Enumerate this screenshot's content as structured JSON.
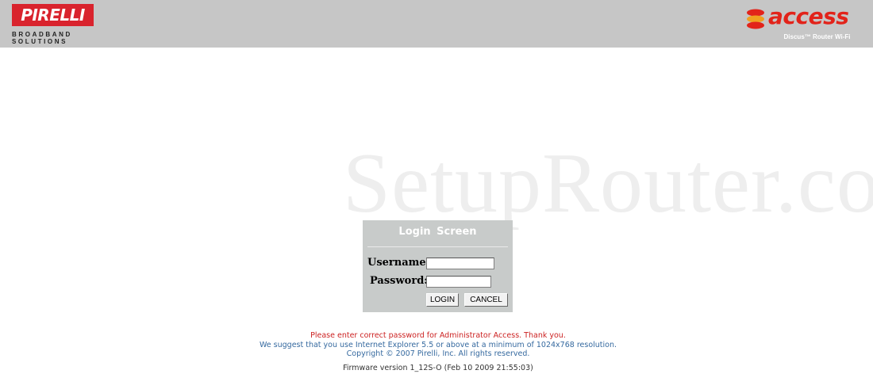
{
  "header": {
    "pirelli_logo_text": "PIRELLI",
    "pirelli_sub_line1": "BROADBAND",
    "pirelli_sub_line2": "SOLUTIONS",
    "access_logo_text": "access",
    "access_tagline": "Discus™ Router Wi-Fi",
    "pirelli_red": "#d9232d",
    "access_red": "#e2231a"
  },
  "watermark": "SetupRouter.co",
  "login": {
    "title": "Login  Screen",
    "username_label": "Username:",
    "password_label": "Password:",
    "username_value": "",
    "password_value": "",
    "login_button": "LOGIN",
    "cancel_button": "CANCEL"
  },
  "footer": {
    "warning": "Please enter correct password for Administrator Access. Thank you.",
    "suggestion": "We suggest that you use Internet Explorer 5.5 or above at a minimum of 1024x768 resolution.",
    "copyright": "Copyright © 2007 Pirelli, Inc. All rights reserved.",
    "firmware": "Firmware version 1_12S-O (Feb 10 2009 21:55:03)"
  }
}
